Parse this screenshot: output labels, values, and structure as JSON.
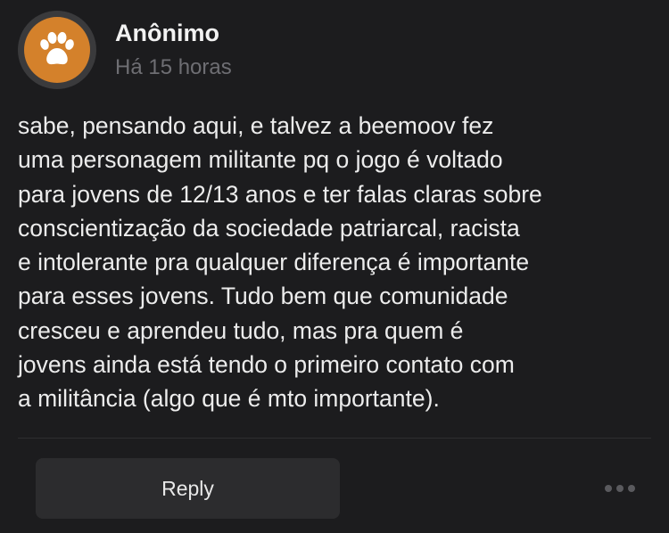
{
  "post": {
    "author": "Anônimo",
    "timestamp": "Há 15 horas",
    "avatar_icon": "paw-icon",
    "avatar_color": "#d4812b",
    "body": "sabe, pensando aqui, e talvez a beemoov fez\numa personagem militante pq o jogo é voltado\npara jovens de 12/13 anos e ter falas claras sobre\nconscientização da sociedade patriarcal, racista\ne intolerante pra qualquer diferença é importante\npara esses jovens. Tudo bem que comunidade\ncresceu e aprendeu tudo, mas pra quem é\njovens ainda está tendo o primeiro contato com\na militância (algo que é mto importante)."
  },
  "actions": {
    "reply_label": "Reply",
    "more_icon": "more-dots-icon"
  }
}
